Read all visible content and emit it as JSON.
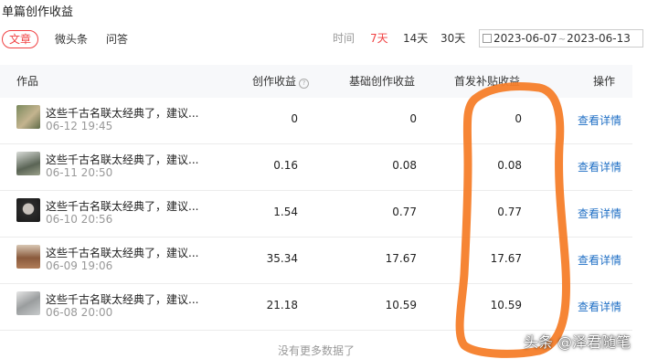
{
  "page": {
    "title": "单篇创作收益"
  },
  "tabs": [
    {
      "label": "文章",
      "active": true
    },
    {
      "label": "微头条",
      "active": false
    },
    {
      "label": "问答",
      "active": false
    }
  ],
  "period": {
    "label": "时间",
    "options": [
      {
        "label": "7天",
        "active": true
      },
      {
        "label": "14天",
        "active": false
      },
      {
        "label": "30天",
        "active": false
      }
    ],
    "date_start": "2023-06-07",
    "date_end": "2023-06-13",
    "date_separator": "~"
  },
  "table": {
    "columns": [
      "作品",
      "创作收益",
      "基础创作收益",
      "首发补贴收益",
      "操作"
    ],
    "help_icon_label": "?",
    "rows": [
      {
        "title": "这些千古名联太经典了，建议...",
        "date": "06-12 19:45",
        "income": "0",
        "base": "0",
        "subsidy": "0",
        "action": "查看详情"
      },
      {
        "title": "这些千古名联太经典了，建议...",
        "date": "06-11 20:50",
        "income": "0.16",
        "base": "0.08",
        "subsidy": "0.08",
        "action": "查看详情"
      },
      {
        "title": "这些千古名联太经典了，建议...",
        "date": "06-10 20:56",
        "income": "1.54",
        "base": "0.77",
        "subsidy": "0.77",
        "action": "查看详情"
      },
      {
        "title": "这些千古名联太经典了，建议...",
        "date": "06-09 19:06",
        "income": "35.34",
        "base": "17.67",
        "subsidy": "17.67",
        "action": "查看详情"
      },
      {
        "title": "这些千古名联太经典了，建议...",
        "date": "06-08 20:00",
        "income": "21.18",
        "base": "10.59",
        "subsidy": "10.59",
        "action": "查看详情"
      }
    ],
    "footer": "没有更多数据了"
  },
  "watermark": "头条 @泽君随笔",
  "colors": {
    "accent": "#f04142",
    "link": "#1f6fc5",
    "annotation": "#f57e2a"
  },
  "icons": {
    "calendar": "calendar-icon",
    "help": "help-circle-icon"
  }
}
